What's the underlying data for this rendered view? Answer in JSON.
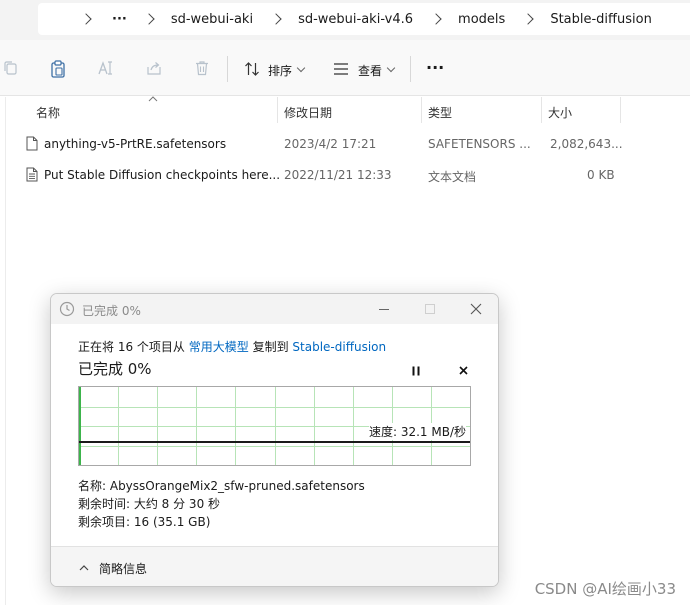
{
  "address_bar": {
    "more": "···",
    "breadcrumbs": [
      "sd-webui-aki",
      "sd-webui-aki-v4.6",
      "models",
      "Stable-diffusion"
    ]
  },
  "toolbar": {
    "sort_label": "排序",
    "view_label": "查看",
    "more": "···"
  },
  "file_list": {
    "columns": [
      "名称",
      "修改日期",
      "类型",
      "大小"
    ],
    "rows": [
      {
        "name": "anything-v5-PrtRE.safetensors",
        "date": "2023/4/2 17:21",
        "type": "SAFETENSORS ...",
        "size": "2,082,643..."
      },
      {
        "name": "Put Stable Diffusion checkpoints here...",
        "date": "2022/11/21 12:33",
        "type": "文本文档",
        "size": "0 KB"
      }
    ]
  },
  "dialog": {
    "window_title": "已完成 0%",
    "copy_prefix": "正在将 16 个项目从",
    "source": "常用大模型",
    "copy_middle": "复制到",
    "destination": "Stable-diffusion",
    "progress_title": "已完成 0%",
    "progress": 0,
    "speed": "速度: 32.1 MB/秒",
    "name_line": "名称: AbyssOrangeMix2_sfw-pruned.safetensors",
    "time_line": "剩余时间: 大约 8 分 30 秒",
    "items_line": "剩余项目: 16 (35.1 GB)",
    "less_details": "简略信息",
    "colors": {
      "link": "#0067c0",
      "progress_green": "#3cb44b",
      "graph_grid": "#b7e4b7"
    }
  },
  "watermark": "CSDN @AI绘画小33"
}
